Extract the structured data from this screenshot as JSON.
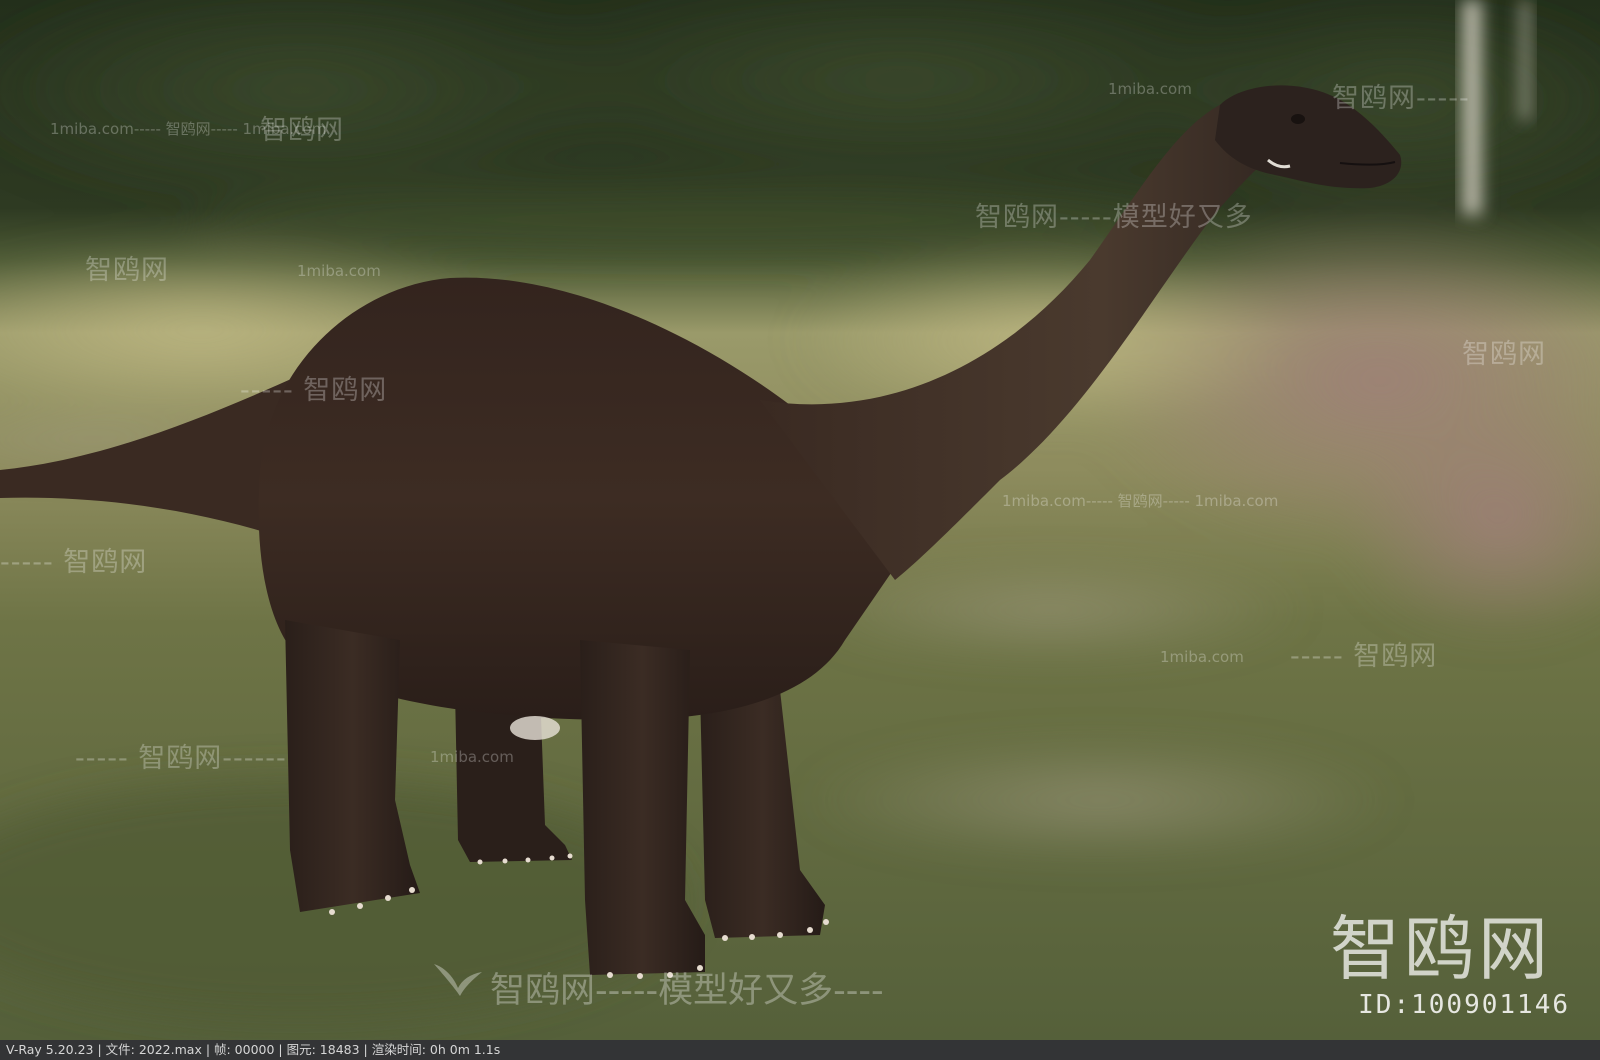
{
  "status_bar": {
    "text": "V-Ray 5.20.23 | 文件: 2022.max | 帧: 00000 | 图元: 18483 | 渲染时间: 0h  0m  1.1s"
  },
  "logo": {
    "brand": "智鸥网",
    "id_text": "ID:100901146"
  },
  "watermarks": {
    "main_slogan": "智鸥网-----模型好又多----",
    "slogan": "智鸥网-----模型好又多",
    "brand": "智鸥网",
    "url": "1miba.com",
    "dash_brand": "----- 智鸥网",
    "brand_dash": "智鸥网-----",
    "url_dash_brand_dash_url": "1miba.com----- 智鸥网----- 1miba.com",
    "url_dash_brand": "1miba.com----- 智鸥网------",
    "dash_brand_dash": "----- 智鸥网------"
  },
  "scene": {
    "subject": "sauropod-dinosaur-render",
    "colors": {
      "forest": "#2e3a22",
      "field": "#8a8a5a",
      "dino_skin": "#3b2a22",
      "heather": "#9a7a70"
    }
  }
}
